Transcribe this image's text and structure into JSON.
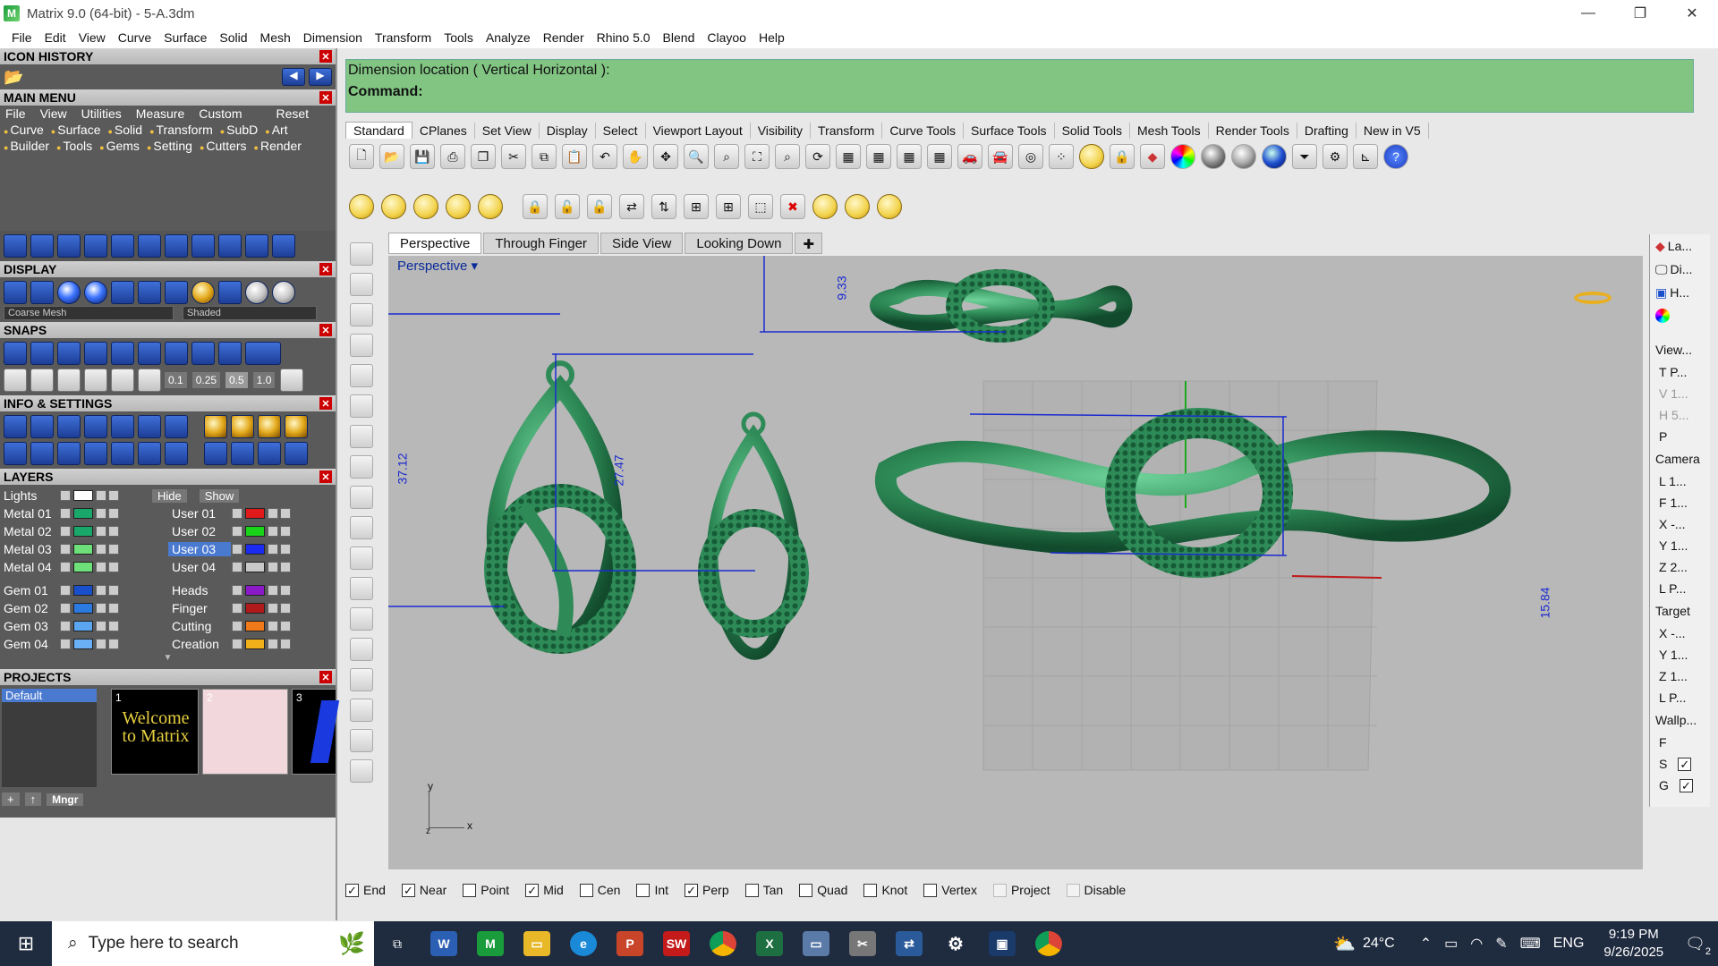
{
  "window": {
    "title": "Matrix 9.0 (64-bit) - 5-A.3dm",
    "min": "—",
    "restore": "❐",
    "close": "✕"
  },
  "menu": [
    "File",
    "Edit",
    "View",
    "Curve",
    "Surface",
    "Solid",
    "Mesh",
    "Dimension",
    "Transform",
    "Tools",
    "Analyze",
    "Render",
    "Rhino 5.0",
    "Blend",
    "Clayoo",
    "Help"
  ],
  "left": {
    "icon_history": "ICON HISTORY",
    "main_menu": "MAIN MENU",
    "mm_row1": [
      "File",
      "View",
      "Utilities",
      "Measure",
      "Custom",
      "Reset"
    ],
    "mm_row2": [
      "Curve",
      "Surface",
      "Solid",
      "Transform",
      "SubD",
      "Art"
    ],
    "mm_row3": [
      "Builder",
      "Tools",
      "Gems",
      "Setting",
      "Cutters",
      "Render"
    ],
    "display": "DISPLAY",
    "display_combo1": "Coarse Mesh",
    "display_combo2": "Shaded",
    "snaps": "SNAPS",
    "snap_values": [
      "0.1",
      "0.25",
      "0.5",
      "1.0"
    ],
    "info": "INFO & SETTINGS",
    "layers": "LAYERS",
    "lights": "Lights",
    "hide": "Hide",
    "show": "Show",
    "layer_left": [
      {
        "name": "Metal 01",
        "color": "#1aa86a"
      },
      {
        "name": "Metal 02",
        "color": "#1aa86a"
      },
      {
        "name": "Metal 03",
        "color": "#6ee07a"
      },
      {
        "name": "Metal 04",
        "color": "#6ee07a"
      },
      {
        "name": "Gem 01",
        "color": "#1a4fcc"
      },
      {
        "name": "Gem 02",
        "color": "#2a7ae0"
      },
      {
        "name": "Gem 03",
        "color": "#5aa6f0"
      },
      {
        "name": "Gem 04",
        "color": "#6ab0f6"
      }
    ],
    "layer_right": [
      {
        "name": "User 01",
        "color": "#e01a1a"
      },
      {
        "name": "User 02",
        "color": "#1ad41a"
      },
      {
        "name": "User 03",
        "color": "#1a2af0"
      },
      {
        "name": "User 04",
        "color": "#c8c8c8"
      },
      {
        "name": "Heads",
        "color": "#8a1ac8"
      },
      {
        "name": "Finger",
        "color": "#b01a1a"
      },
      {
        "name": "Cutting",
        "color": "#f07a1a"
      },
      {
        "name": "Creation",
        "color": "#f0b01a"
      }
    ],
    "projects": "PROJECTS",
    "project_default": "Default",
    "thumb1": "1",
    "thumb1_text": "Welcome to Matrix",
    "thumb2": "2",
    "thumb3": "3",
    "mngr": "Mngr"
  },
  "command": {
    "prompt": "Dimension location ( Vertical  Horizontal ):",
    "label": "Command:"
  },
  "toolbar_tabs": [
    "Standard",
    "CPlanes",
    "Set View",
    "Display",
    "Select",
    "Viewport Layout",
    "Visibility",
    "Transform",
    "Curve Tools",
    "Surface Tools",
    "Solid Tools",
    "Mesh Tools",
    "Render Tools",
    "Drafting",
    "New in V5"
  ],
  "viewport_tabs": [
    "Perspective",
    "Through Finger",
    "Side View",
    "Looking Down"
  ],
  "viewport": {
    "label": "Perspective",
    "dims": {
      "d1": "9.33",
      "d2": "37.12",
      "d3": "27.47",
      "d4": "15.84"
    },
    "axis_y": "y",
    "axis_x": "x",
    "axis_z": "z"
  },
  "right": {
    "tabs": [
      "La...",
      "Di...",
      "H..."
    ],
    "view": "View...",
    "view_rows": [
      "T P...",
      "V 1...",
      "H 5...",
      "P"
    ],
    "camera": "Camera",
    "camera_rows": [
      "L 1...",
      "F 1...",
      "X -...",
      "Y 1...",
      "Z 2...",
      "L P..."
    ],
    "target": "Target",
    "target_rows": [
      "X -...",
      "Y 1...",
      "Z 1...",
      "L P..."
    ],
    "wallp": "Wallp...",
    "wallp_rows": [
      "F",
      "S",
      "G"
    ]
  },
  "osnap": [
    {
      "label": "End",
      "checked": true
    },
    {
      "label": "Near",
      "checked": true
    },
    {
      "label": "Point",
      "checked": false
    },
    {
      "label": "Mid",
      "checked": true
    },
    {
      "label": "Cen",
      "checked": false
    },
    {
      "label": "Int",
      "checked": false
    },
    {
      "label": "Perp",
      "checked": true
    },
    {
      "label": "Tan",
      "checked": false
    },
    {
      "label": "Quad",
      "checked": false
    },
    {
      "label": "Knot",
      "checked": false
    },
    {
      "label": "Vertex",
      "checked": false
    },
    {
      "label": "Project",
      "checked": false
    },
    {
      "label": "Disable",
      "checked": false
    }
  ],
  "taskbar": {
    "search_placeholder": "Type here to search",
    "weather": "24°C",
    "lang": "ENG",
    "time": "9:19 PM",
    "date": "9/26/2025",
    "notif": "2"
  },
  "colors": {
    "model": "#2e8b57",
    "dimension": "#1a2ad0",
    "cmd_bg": "#82c583"
  }
}
